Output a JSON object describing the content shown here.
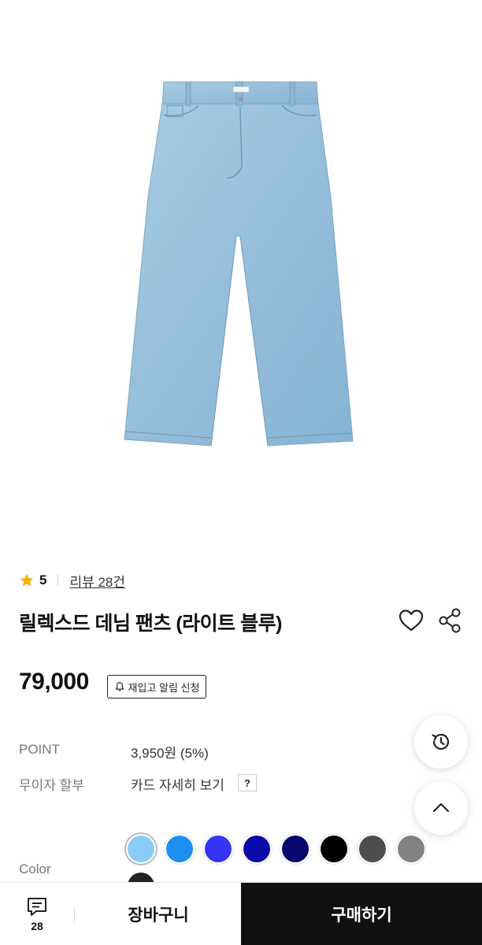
{
  "product": {
    "rating": "5",
    "review_link": "리뷰 28건",
    "title": "릴렉스드 데님 팬츠 (라이트 블루)",
    "price": "79,000",
    "restock_label": "재입고 알림 신청"
  },
  "info": {
    "point_label": "POINT",
    "point_value": "3,950원 (5%)",
    "installment_label": "무이자 할부",
    "installment_value": "카드 자세히 보기",
    "help": "?"
  },
  "options": {
    "color_label": "Color",
    "swatches": [
      "#89cdf6",
      "#1e8ff0",
      "#3434f5",
      "#0a0aa8",
      "#06066e",
      "#000000",
      "#4d4d4d",
      "#828282"
    ],
    "selected_index": 0
  },
  "bottom_bar": {
    "chat_count": "28",
    "cart_label": "장바구니",
    "buy_label": "구매하기"
  },
  "icons": {
    "rating": "star-icon",
    "wish": "heart-icon",
    "share": "share-icon",
    "restock": "bell-icon",
    "history": "history-icon",
    "scroll_top": "chevron-up-icon",
    "chat": "chat-icon"
  },
  "colors": {
    "star": "#f6b100",
    "buy_button": "#111111",
    "denim": "#9cc3de"
  }
}
